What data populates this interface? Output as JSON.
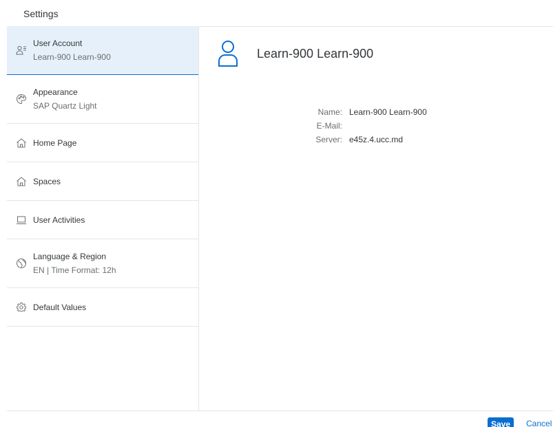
{
  "dialog": {
    "title": "Settings"
  },
  "sidebar": {
    "items": [
      {
        "label": "User Account",
        "sublabel": "Learn-900 Learn-900",
        "icon": "user-settings-icon",
        "selected": true
      },
      {
        "label": "Appearance",
        "sublabel": "SAP Quartz Light",
        "icon": "palette-icon"
      },
      {
        "label": "Home Page",
        "sublabel": "",
        "icon": "home-icon"
      },
      {
        "label": "Spaces",
        "sublabel": "",
        "icon": "home-icon"
      },
      {
        "label": "User Activities",
        "sublabel": "",
        "icon": "laptop-icon"
      },
      {
        "label": "Language & Region",
        "sublabel": "EN | Time Format: 12h",
        "icon": "globe-icon"
      },
      {
        "label": "Default Values",
        "sublabel": "",
        "icon": "gear-icon"
      }
    ]
  },
  "account": {
    "header_name": "Learn-900 Learn-900",
    "fields": [
      {
        "label": "Name:",
        "value": "Learn-900 Learn-900"
      },
      {
        "label": "E-Mail:",
        "value": ""
      },
      {
        "label": "Server:",
        "value": "e45z.4.ucc.md"
      }
    ]
  },
  "footer": {
    "save_label": "Save",
    "cancel_label": "Cancel"
  },
  "colors": {
    "accent": "#0a6ed1",
    "selected_bg": "#e5f0fa",
    "border": "#e5e5e5",
    "text": "#32363a",
    "muted": "#6a6d70"
  }
}
